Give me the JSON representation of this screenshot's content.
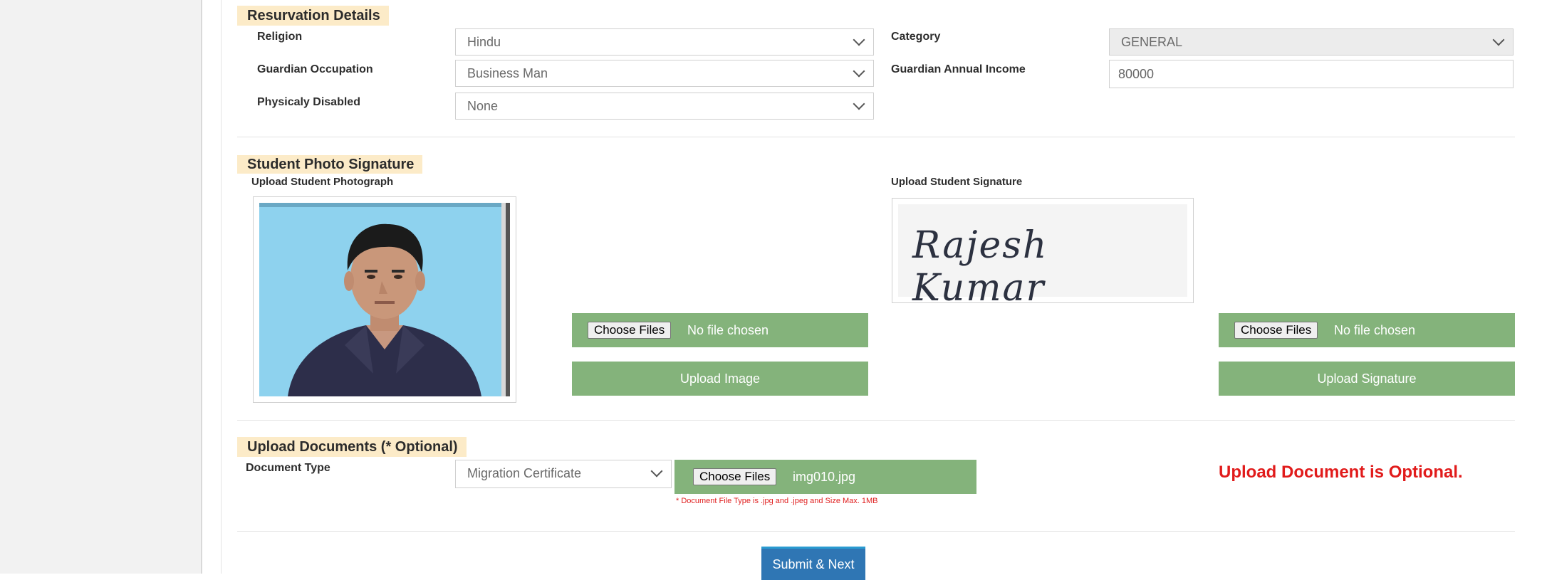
{
  "reservation": {
    "section_title": "Resurvation Details",
    "religion_label": "Religion",
    "religion_value": "Hindu",
    "category_label": "Category",
    "category_value": "GENERAL",
    "occupation_label": "Guardian Occupation",
    "occupation_value": "Business Man",
    "income_label": "Guardian Annual Income",
    "income_value": "80000",
    "disabled_label": "Physicaly Disabled",
    "disabled_value": "None"
  },
  "photo_signature": {
    "section_title": "Student Photo Signature",
    "photo_label": "Upload Student Photograph",
    "signature_label": "Upload Student Signature",
    "signature_text": "Rajesh Kumar",
    "photo_choose_button": "Choose Files",
    "photo_file_status": "No file chosen",
    "upload_image_button": "Upload Image",
    "signature_choose_button": "Choose Files",
    "signature_file_status": "No file chosen",
    "upload_signature_button": "Upload Signature"
  },
  "documents": {
    "section_title": "Upload Documents (* Optional)",
    "doc_type_label": "Document Type",
    "doc_type_value": "Migration Certificate",
    "choose_button": "Choose Files",
    "file_name": "img010.jpg",
    "hint": "* Document File Type is .jpg and .jpeg and Size Max. 1MB",
    "optional_note": "Upload Document is Optional."
  },
  "footer": {
    "submit_label": "Submit & Next"
  },
  "colors": {
    "green": "#84b37b",
    "section_bg": "#fcebc8",
    "error_red": "#e11b1b",
    "submit_blue": "#2f76b4"
  }
}
